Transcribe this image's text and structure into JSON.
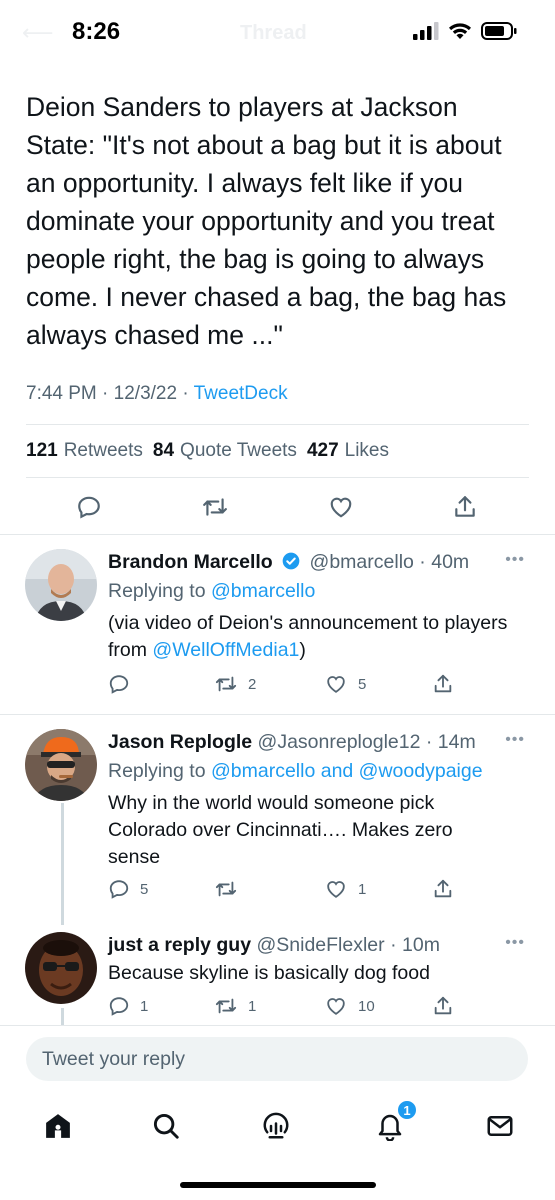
{
  "status_bar": {
    "time": "8:26",
    "ghost_title": "Thread"
  },
  "main_tweet": {
    "text": "Deion Sanders to players at Jackson State: \"It's not about a bag but it is about an opportunity. I always felt like if you dominate your opportunity and you treat people right, the bag is going to always come. I never chased a bag, the bag has always chased me ...\"",
    "time": "7:44 PM",
    "date": "12/3/22",
    "source": "TweetDeck",
    "retweets_count": "121",
    "retweets_label": "Retweets",
    "quotes_count": "84",
    "quotes_label": "Quote Tweets",
    "likes_count": "427",
    "likes_label": "Likes"
  },
  "replies": [
    {
      "name": "Brandon Marcello",
      "handle": "@bmarcello",
      "time": "40m",
      "verified": true,
      "replying_label": "Replying to",
      "replying_to": "@bmarcello",
      "text_before": "(via video of Deion's announcement to players from ",
      "text_mention": "@WellOffMedia1",
      "text_after": ")",
      "reply_count": "",
      "retweet_count": "2",
      "like_count": "5"
    },
    {
      "name": "Jason Replogle",
      "handle": "@Jasonreplogle12",
      "time": "14m",
      "replying_label": "Replying to",
      "replying_to": "@bmarcello and @woodypaige",
      "text": "Why in the world would someone pick Colorado over Cincinnati…. Makes zero sense",
      "reply_count": "5",
      "retweet_count": "",
      "like_count": "1"
    },
    {
      "name": "just a reply guy",
      "handle": "@SnideFlexler",
      "time": "10m",
      "text": "Because skyline is basically dog food",
      "reply_count": "1",
      "retweet_count": "1",
      "like_count": "10"
    }
  ],
  "compose": {
    "placeholder": "Tweet your reply"
  },
  "bottom_nav": {
    "notification_badge": "1",
    "items": [
      "home-icon",
      "search-icon",
      "spaces-icon",
      "notifications-icon",
      "messages-icon"
    ]
  },
  "colors": {
    "accent": "#1d9bf0",
    "text": "#0f1419",
    "secondary": "#536471"
  }
}
